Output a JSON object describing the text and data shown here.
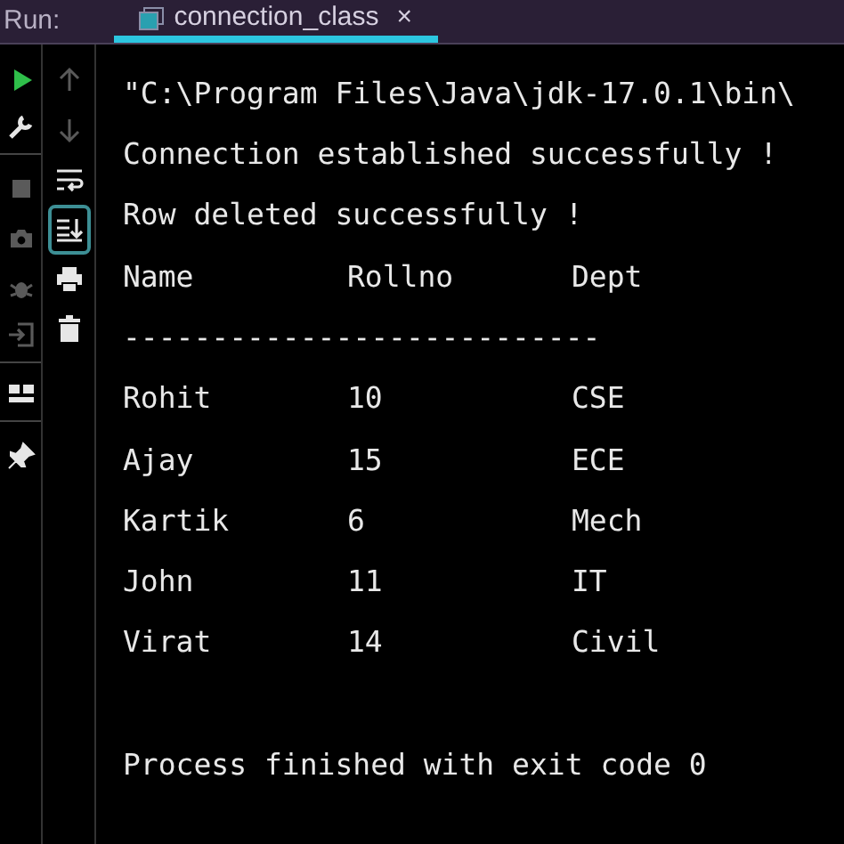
{
  "run_label": "Run:",
  "tabs": [
    {
      "label": "connection_class",
      "close": "×",
      "selected": true
    }
  ],
  "left_toolbar": [
    {
      "kind": "run",
      "disabled": false
    },
    {
      "kind": "wrench",
      "disabled": false
    },
    {
      "kind": "stop",
      "disabled": true
    },
    {
      "kind": "camera",
      "disabled": true
    },
    {
      "kind": "bug",
      "disabled": true
    },
    {
      "kind": "exit",
      "disabled": true
    },
    {
      "kind": "layout",
      "disabled": false
    },
    {
      "kind": "pin",
      "disabled": false
    }
  ],
  "console_toolbar": [
    {
      "kind": "up",
      "disabled": true,
      "selected": false
    },
    {
      "kind": "down",
      "disabled": true,
      "selected": false
    },
    {
      "kind": "wrap",
      "disabled": false,
      "selected": false
    },
    {
      "kind": "scroll-end",
      "disabled": false,
      "selected": true
    },
    {
      "kind": "print",
      "disabled": false,
      "selected": false
    },
    {
      "kind": "trash",
      "disabled": false,
      "selected": false
    }
  ],
  "console_lines": [
    {
      "kind": "text",
      "text": "\"C:\\Program Files\\Java\\jdk-17.0.1\\bin\\"
    },
    {
      "kind": "text",
      "text": "Connection established successfully !"
    },
    {
      "kind": "text",
      "text": "Row deleted successfully !"
    },
    {
      "kind": "row",
      "cells": [
        "Name",
        "Rollno",
        "Dept"
      ]
    },
    {
      "kind": "text",
      "text": "---------------------------"
    },
    {
      "kind": "row",
      "cells": [
        "Rohit",
        "10",
        "CSE"
      ]
    },
    {
      "kind": "row",
      "cells": [
        "Ajay",
        "15",
        "ECE"
      ]
    },
    {
      "kind": "row",
      "cells": [
        "Kartik",
        "6",
        "Mech"
      ]
    },
    {
      "kind": "row",
      "cells": [
        "John",
        "11",
        "IT"
      ]
    },
    {
      "kind": "row",
      "cells": [
        "Virat",
        "14",
        "Civil"
      ]
    },
    {
      "kind": "blank"
    },
    {
      "kind": "text",
      "text": "Process finished with exit code 0"
    }
  ]
}
